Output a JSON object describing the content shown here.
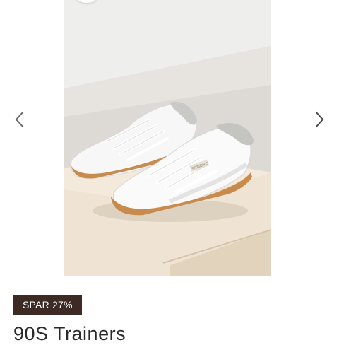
{
  "gallery": {
    "image_alt": "White sneakers with gum soles on a wooden block",
    "prev_icon": "chevron-left-icon",
    "next_icon": "chevron-right-icon",
    "shoe_brand_text": "SANDRO"
  },
  "product": {
    "discount_badge": "SPAR 27%",
    "title": "90S Trainers"
  },
  "colors": {
    "badge_bg": "#3d2a24",
    "badge_text": "#ffffff",
    "arrow": "#555555",
    "sole_gum": "#c98a4e"
  }
}
